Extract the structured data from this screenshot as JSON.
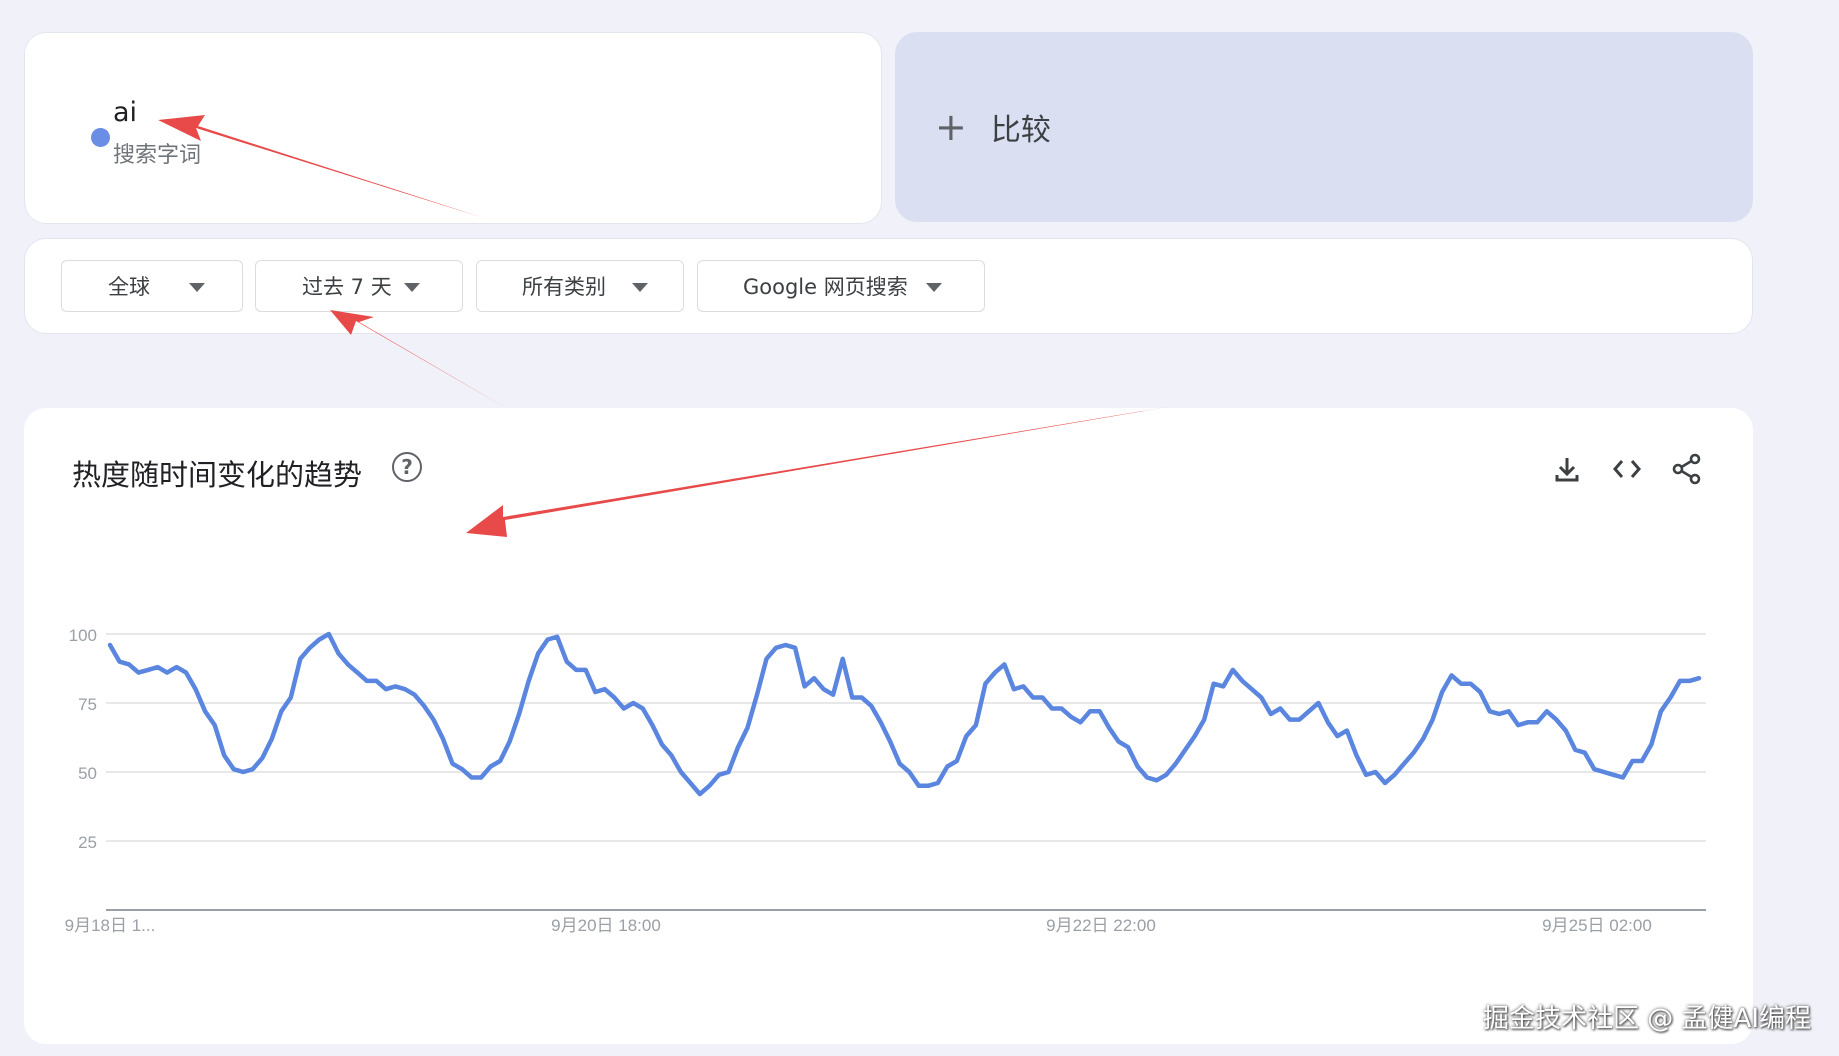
{
  "search_term": {
    "name": "ai",
    "type_label": "搜索字词",
    "color": "#6a8de6"
  },
  "compare": {
    "icon": "plus-icon",
    "label": "比较"
  },
  "filters": [
    {
      "label": "全球"
    },
    {
      "label": "过去 7 天"
    },
    {
      "label": "所有类别"
    },
    {
      "label": "Google 网页搜索"
    }
  ],
  "chart_card": {
    "title": "热度随时间变化的趋势"
  },
  "watermark": "掘金技术社区 @ 孟健AI编程",
  "chart_data": {
    "type": "line",
    "title": "",
    "xlabel": "",
    "ylabel": "",
    "ylim": [
      0,
      100
    ],
    "yticks": [
      100,
      75,
      50,
      25
    ],
    "xtick_labels": [
      "9月18日 1...",
      "9月20日 18:00",
      "9月22日 22:00",
      "9月25日 02:00"
    ],
    "grid": true,
    "series": [
      {
        "color": "#5b86e0",
        "values": [
          96,
          90,
          89,
          86,
          87,
          88,
          86,
          88,
          86,
          80,
          72,
          67,
          56,
          51,
          50,
          51,
          55,
          62,
          72,
          77,
          91,
          95,
          98,
          100,
          93,
          89,
          86,
          83,
          83,
          80,
          81,
          80,
          78,
          74,
          69,
          62,
          53,
          51,
          48,
          48,
          52,
          54,
          61,
          71,
          83,
          93,
          98,
          99,
          90,
          87,
          87,
          79,
          80,
          77,
          73,
          75,
          73,
          67,
          60,
          56,
          50,
          46,
          42,
          45,
          49,
          50,
          59,
          66,
          78,
          91,
          95,
          96,
          95,
          81,
          84,
          80,
          78,
          91,
          77,
          77,
          74,
          68,
          61,
          53,
          50,
          45,
          45,
          46,
          52,
          54,
          63,
          67,
          82,
          86,
          89,
          80,
          81,
          77,
          77,
          73,
          73,
          70,
          68,
          72,
          72,
          66,
          61,
          59,
          52,
          48,
          47,
          49,
          53,
          58,
          63,
          69,
          82,
          81,
          87,
          83,
          80,
          77,
          71,
          73,
          69,
          69,
          72,
          75,
          68,
          63,
          65,
          56,
          49,
          50,
          46,
          49,
          53,
          57,
          62,
          69,
          79,
          85,
          82,
          82,
          79,
          72,
          71,
          72,
          67,
          68,
          68,
          72,
          69,
          65,
          58,
          57,
          51,
          50,
          49,
          48,
          54,
          54,
          60,
          72,
          77,
          83,
          83,
          84
        ]
      }
    ]
  }
}
